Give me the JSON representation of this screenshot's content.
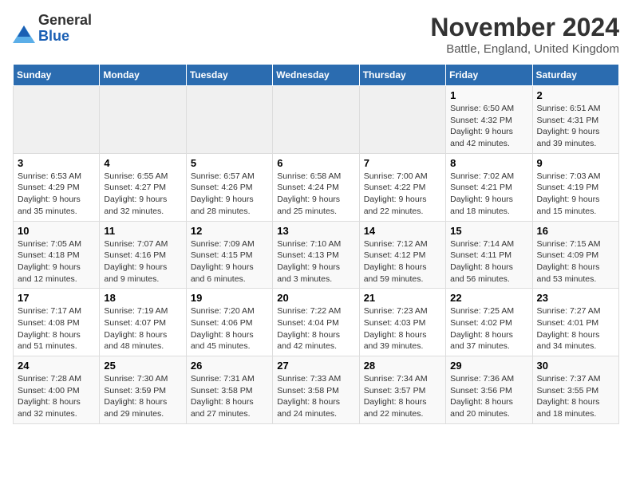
{
  "header": {
    "logo_general": "General",
    "logo_blue": "Blue",
    "month_title": "November 2024",
    "location": "Battle, England, United Kingdom"
  },
  "weekdays": [
    "Sunday",
    "Monday",
    "Tuesday",
    "Wednesday",
    "Thursday",
    "Friday",
    "Saturday"
  ],
  "weeks": [
    [
      {
        "day": "",
        "info": ""
      },
      {
        "day": "",
        "info": ""
      },
      {
        "day": "",
        "info": ""
      },
      {
        "day": "",
        "info": ""
      },
      {
        "day": "",
        "info": ""
      },
      {
        "day": "1",
        "info": "Sunrise: 6:50 AM\nSunset: 4:32 PM\nDaylight: 9 hours\nand 42 minutes."
      },
      {
        "day": "2",
        "info": "Sunrise: 6:51 AM\nSunset: 4:31 PM\nDaylight: 9 hours\nand 39 minutes."
      }
    ],
    [
      {
        "day": "3",
        "info": "Sunrise: 6:53 AM\nSunset: 4:29 PM\nDaylight: 9 hours\nand 35 minutes."
      },
      {
        "day": "4",
        "info": "Sunrise: 6:55 AM\nSunset: 4:27 PM\nDaylight: 9 hours\nand 32 minutes."
      },
      {
        "day": "5",
        "info": "Sunrise: 6:57 AM\nSunset: 4:26 PM\nDaylight: 9 hours\nand 28 minutes."
      },
      {
        "day": "6",
        "info": "Sunrise: 6:58 AM\nSunset: 4:24 PM\nDaylight: 9 hours\nand 25 minutes."
      },
      {
        "day": "7",
        "info": "Sunrise: 7:00 AM\nSunset: 4:22 PM\nDaylight: 9 hours\nand 22 minutes."
      },
      {
        "day": "8",
        "info": "Sunrise: 7:02 AM\nSunset: 4:21 PM\nDaylight: 9 hours\nand 18 minutes."
      },
      {
        "day": "9",
        "info": "Sunrise: 7:03 AM\nSunset: 4:19 PM\nDaylight: 9 hours\nand 15 minutes."
      }
    ],
    [
      {
        "day": "10",
        "info": "Sunrise: 7:05 AM\nSunset: 4:18 PM\nDaylight: 9 hours\nand 12 minutes."
      },
      {
        "day": "11",
        "info": "Sunrise: 7:07 AM\nSunset: 4:16 PM\nDaylight: 9 hours\nand 9 minutes."
      },
      {
        "day": "12",
        "info": "Sunrise: 7:09 AM\nSunset: 4:15 PM\nDaylight: 9 hours\nand 6 minutes."
      },
      {
        "day": "13",
        "info": "Sunrise: 7:10 AM\nSunset: 4:13 PM\nDaylight: 9 hours\nand 3 minutes."
      },
      {
        "day": "14",
        "info": "Sunrise: 7:12 AM\nSunset: 4:12 PM\nDaylight: 8 hours\nand 59 minutes."
      },
      {
        "day": "15",
        "info": "Sunrise: 7:14 AM\nSunset: 4:11 PM\nDaylight: 8 hours\nand 56 minutes."
      },
      {
        "day": "16",
        "info": "Sunrise: 7:15 AM\nSunset: 4:09 PM\nDaylight: 8 hours\nand 53 minutes."
      }
    ],
    [
      {
        "day": "17",
        "info": "Sunrise: 7:17 AM\nSunset: 4:08 PM\nDaylight: 8 hours\nand 51 minutes."
      },
      {
        "day": "18",
        "info": "Sunrise: 7:19 AM\nSunset: 4:07 PM\nDaylight: 8 hours\nand 48 minutes."
      },
      {
        "day": "19",
        "info": "Sunrise: 7:20 AM\nSunset: 4:06 PM\nDaylight: 8 hours\nand 45 minutes."
      },
      {
        "day": "20",
        "info": "Sunrise: 7:22 AM\nSunset: 4:04 PM\nDaylight: 8 hours\nand 42 minutes."
      },
      {
        "day": "21",
        "info": "Sunrise: 7:23 AM\nSunset: 4:03 PM\nDaylight: 8 hours\nand 39 minutes."
      },
      {
        "day": "22",
        "info": "Sunrise: 7:25 AM\nSunset: 4:02 PM\nDaylight: 8 hours\nand 37 minutes."
      },
      {
        "day": "23",
        "info": "Sunrise: 7:27 AM\nSunset: 4:01 PM\nDaylight: 8 hours\nand 34 minutes."
      }
    ],
    [
      {
        "day": "24",
        "info": "Sunrise: 7:28 AM\nSunset: 4:00 PM\nDaylight: 8 hours\nand 32 minutes."
      },
      {
        "day": "25",
        "info": "Sunrise: 7:30 AM\nSunset: 3:59 PM\nDaylight: 8 hours\nand 29 minutes."
      },
      {
        "day": "26",
        "info": "Sunrise: 7:31 AM\nSunset: 3:58 PM\nDaylight: 8 hours\nand 27 minutes."
      },
      {
        "day": "27",
        "info": "Sunrise: 7:33 AM\nSunset: 3:58 PM\nDaylight: 8 hours\nand 24 minutes."
      },
      {
        "day": "28",
        "info": "Sunrise: 7:34 AM\nSunset: 3:57 PM\nDaylight: 8 hours\nand 22 minutes."
      },
      {
        "day": "29",
        "info": "Sunrise: 7:36 AM\nSunset: 3:56 PM\nDaylight: 8 hours\nand 20 minutes."
      },
      {
        "day": "30",
        "info": "Sunrise: 7:37 AM\nSunset: 3:55 PM\nDaylight: 8 hours\nand 18 minutes."
      }
    ]
  ]
}
